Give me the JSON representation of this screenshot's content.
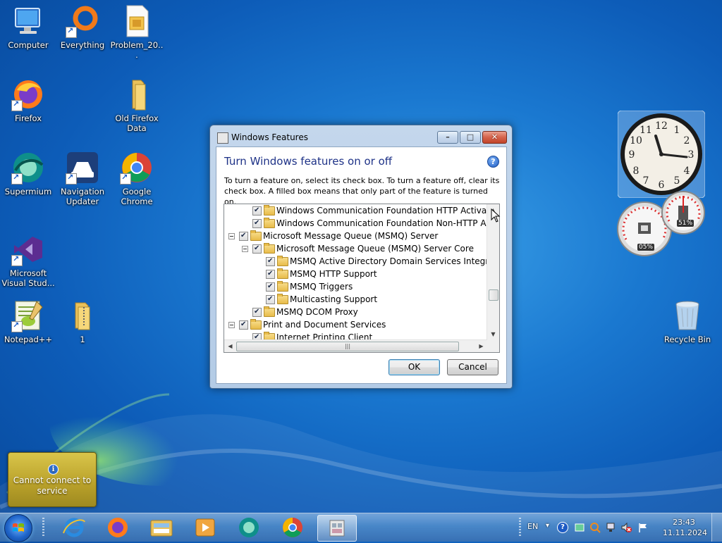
{
  "desktop": {
    "icons": [
      {
        "label": "Computer"
      },
      {
        "label": "Everything"
      },
      {
        "label": "Problem_20..."
      },
      {
        "label": "Firefox"
      },
      {
        "label": "Old Firefox Data"
      },
      {
        "label": "Supermium"
      },
      {
        "label": "Navigation Updater"
      },
      {
        "label": "Google Chrome"
      },
      {
        "label": "Microsoft Visual Stud..."
      },
      {
        "label": "Notepad++"
      },
      {
        "label": "1"
      },
      {
        "label": "Recycle Bin"
      }
    ]
  },
  "gadgets": {
    "meter_cpu": "05%",
    "meter_mem": "51%"
  },
  "notification": {
    "text": "Cannot connect to service"
  },
  "window": {
    "title": "Windows Features",
    "heading": "Turn Windows features on or off",
    "description": "To turn a feature on, select its check box. To turn a feature off, clear its check box. A filled box means that only part of the feature is turned on.",
    "tree": [
      {
        "label": "Windows Communication Foundation HTTP Activation",
        "checked": true
      },
      {
        "label": "Windows Communication Foundation Non-HTTP Activa",
        "checked": true
      },
      {
        "label": "Microsoft Message Queue (MSMQ) Server",
        "checked": true
      },
      {
        "label": "Microsoft Message Queue (MSMQ) Server Core",
        "checked": true
      },
      {
        "label": "MSMQ Active Directory Domain Services Integration",
        "checked": true
      },
      {
        "label": "MSMQ HTTP Support",
        "checked": true
      },
      {
        "label": "MSMQ Triggers",
        "checked": true
      },
      {
        "label": "Multicasting Support",
        "checked": true
      },
      {
        "label": "MSMQ DCOM Proxy",
        "checked": true
      },
      {
        "label": "Print and Document Services",
        "checked": true
      },
      {
        "label": "Internet Printing Client",
        "checked": true
      }
    ],
    "ok_label": "OK",
    "cancel_label": "Cancel"
  },
  "taskbar": {
    "language": "EN",
    "time": "23:43",
    "date": "11.11.2024"
  },
  "colors": {
    "accent": "#1e3287",
    "wallpaper": "#1a78d0"
  }
}
